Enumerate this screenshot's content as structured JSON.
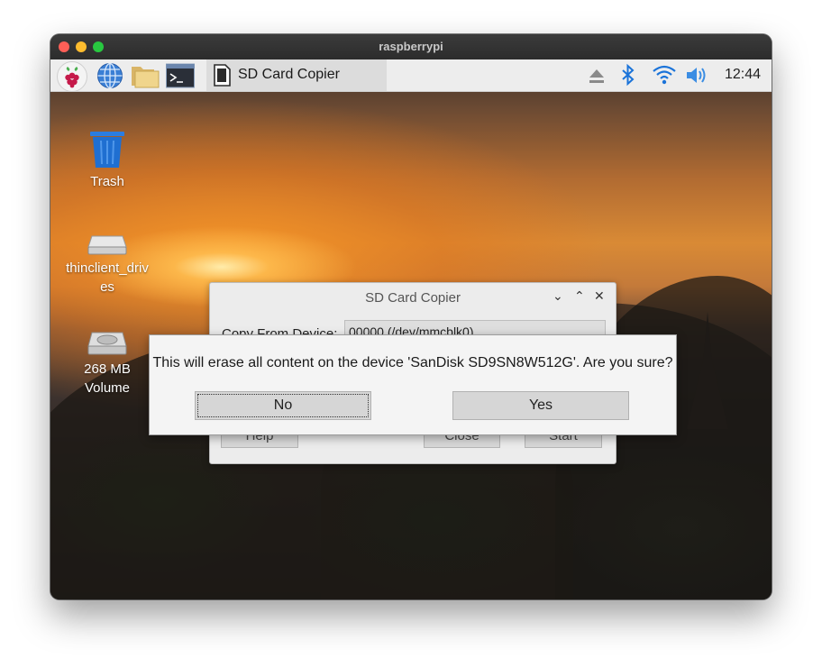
{
  "mac_window": {
    "title": "raspberrypi"
  },
  "taskbar": {
    "active_task": "SD Card Copier",
    "clock": "12:44",
    "launchers": [
      "raspberry-pi-menu-icon",
      "web-browser-icon",
      "file-manager-icon",
      "terminal-icon"
    ],
    "tray_icons": [
      "eject-icon",
      "bluetooth-icon",
      "wifi-icon",
      "volume-icon"
    ]
  },
  "desktop_icons": [
    {
      "label": "Trash",
      "icon": "trash-icon"
    },
    {
      "label": "thinclient_driv\nes",
      "icon": "drive-icon"
    },
    {
      "label": "268 MB\nVolume",
      "icon": "disk-icon"
    }
  ],
  "copier_window": {
    "title": "SD Card Copier",
    "copy_from_label": "Copy From Device:",
    "copy_from_value": "00000  (/dev/mmcblk0)",
    "help_label": "Help",
    "close_label": "Close",
    "start_label": "Start"
  },
  "confirm_dialog": {
    "message": "This will erase all content on the device 'SanDisk SD9SN8W512G'. Are you sure?",
    "no_label": "No",
    "yes_label": "Yes"
  },
  "colors": {
    "bluetooth": "#1a73d9",
    "trash": "#1f6fd1",
    "taskbar": "#ededed"
  }
}
